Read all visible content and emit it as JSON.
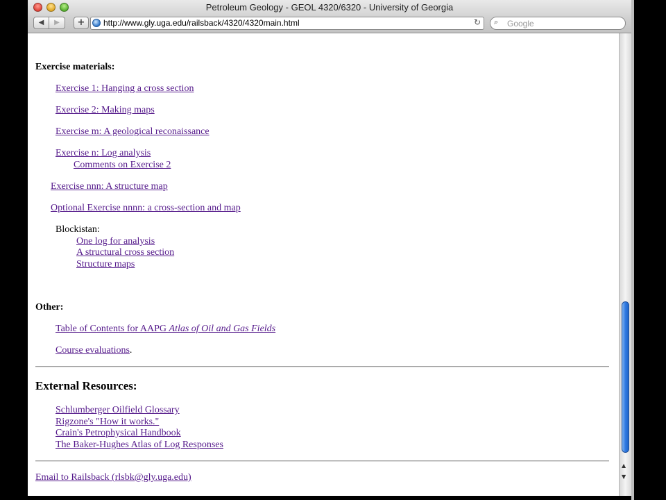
{
  "window": {
    "title": "Petroleum Geology - GEOL 4320/6320 - University of Georgia",
    "url": "http://www.gly.uga.edu/railsback/4320/4320main.html",
    "search_placeholder": "Google",
    "back_glyph": "◀",
    "forward_glyph": "▶",
    "add_glyph": "+",
    "reload_glyph": "↻",
    "search_glyph": "⌕"
  },
  "exercise": {
    "heading": "Exercise materials:",
    "ex1": "Exercise 1: Hanging a cross section",
    "ex2": "Exercise 2: Making maps",
    "exm": "Exercise m: A geological reconaissance",
    "exn": "Exercise n: Log analysis",
    "comments": "Comments on Exercise 2",
    "exnnn": "Exercise nnn: A structure map",
    "exnnnn": "Optional Exercise nnnn: a cross-section and map",
    "blockistan_label": "Blockistan:",
    "blockistan_items": [
      "One log for analysis",
      "A structural cross section",
      "Structure maps"
    ]
  },
  "other": {
    "heading": "Other:",
    "toc_prefix": "Table of Contents for AAPG ",
    "toc_italic": "Atlas of Oil and Gas Fields",
    "evaluations": "Course evaluations",
    "evaluations_suffix": "."
  },
  "external": {
    "heading": "External Resources:",
    "links": [
      "Schlumberger Oilfield Glossary",
      "Rigzone's \"How it works.\"",
      "Crain's Petrophysical Handbook",
      "The Baker-Hughes Atlas of Log Responses"
    ]
  },
  "footer": {
    "email": "Email to Railsback (rlsbk@gly.uga.edu)"
  },
  "colors": {
    "link": "#551a8b",
    "scroll_thumb": "#2f7ae3"
  }
}
